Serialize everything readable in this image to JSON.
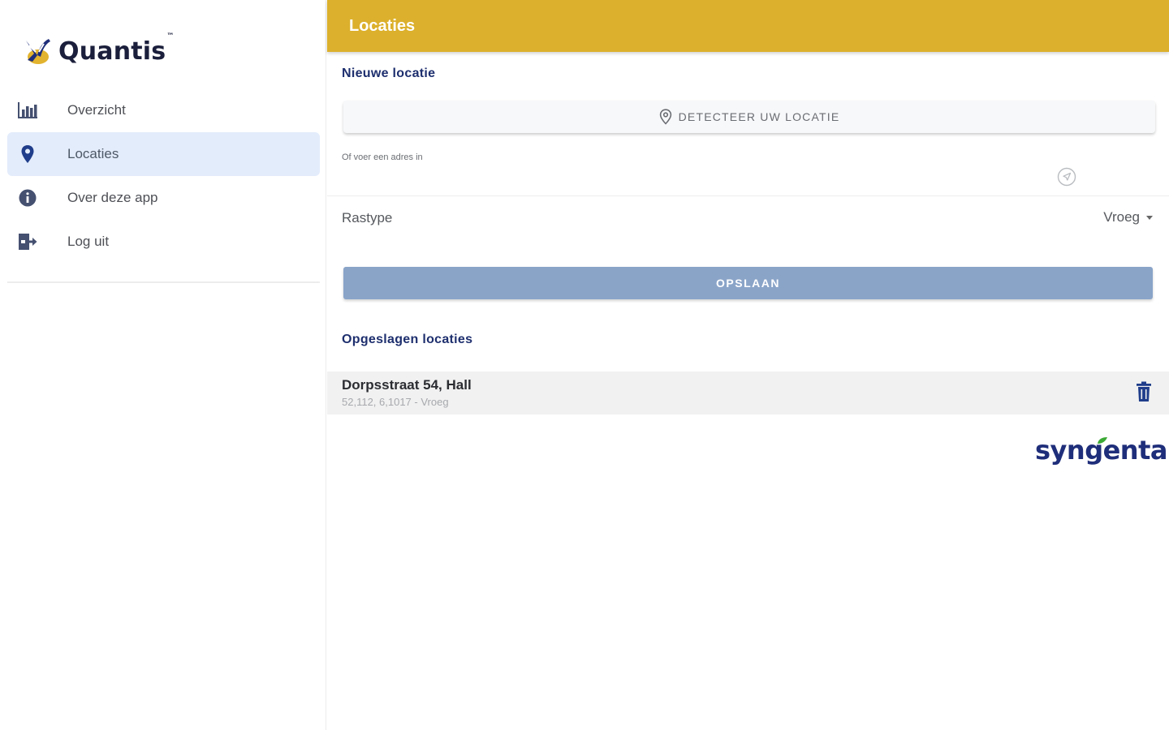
{
  "sidebar": {
    "logo": {
      "brand": "Quantis",
      "tm": "™"
    },
    "items": [
      {
        "id": "overzicht",
        "label": "Overzicht",
        "icon": "bar-chart-icon",
        "active": false
      },
      {
        "id": "locaties",
        "label": "Locaties",
        "icon": "map-pin-icon",
        "active": true
      },
      {
        "id": "over",
        "label": "Over deze app",
        "icon": "info-icon",
        "active": false
      },
      {
        "id": "logout",
        "label": "Log uit",
        "icon": "logout-icon",
        "active": false
      }
    ]
  },
  "header": {
    "title": "Locaties"
  },
  "new_location": {
    "section_title": "Nieuwe locatie",
    "detect_button_label": "DETECTEER UW LOCATIE",
    "address_label": "Of voer een adres in",
    "address_value": "",
    "rastype_label": "Rastype",
    "rastype_value": "Vroeg",
    "save_button_label": "OPSLAAN"
  },
  "saved_locations": {
    "section_title": "Opgeslagen locaties",
    "items": [
      {
        "title": "Dorpsstraat 54, Hall",
        "subtitle": "52,112, 6,1017 - Vroeg"
      }
    ]
  },
  "footer": {
    "brand": "syngenta"
  },
  "colors": {
    "header": "#dcb02c",
    "primary": "#1e2f6e",
    "active_nav": "#e3ecfb",
    "save_button": "#8aa4c8",
    "row_bg": "#f1f1f1"
  }
}
